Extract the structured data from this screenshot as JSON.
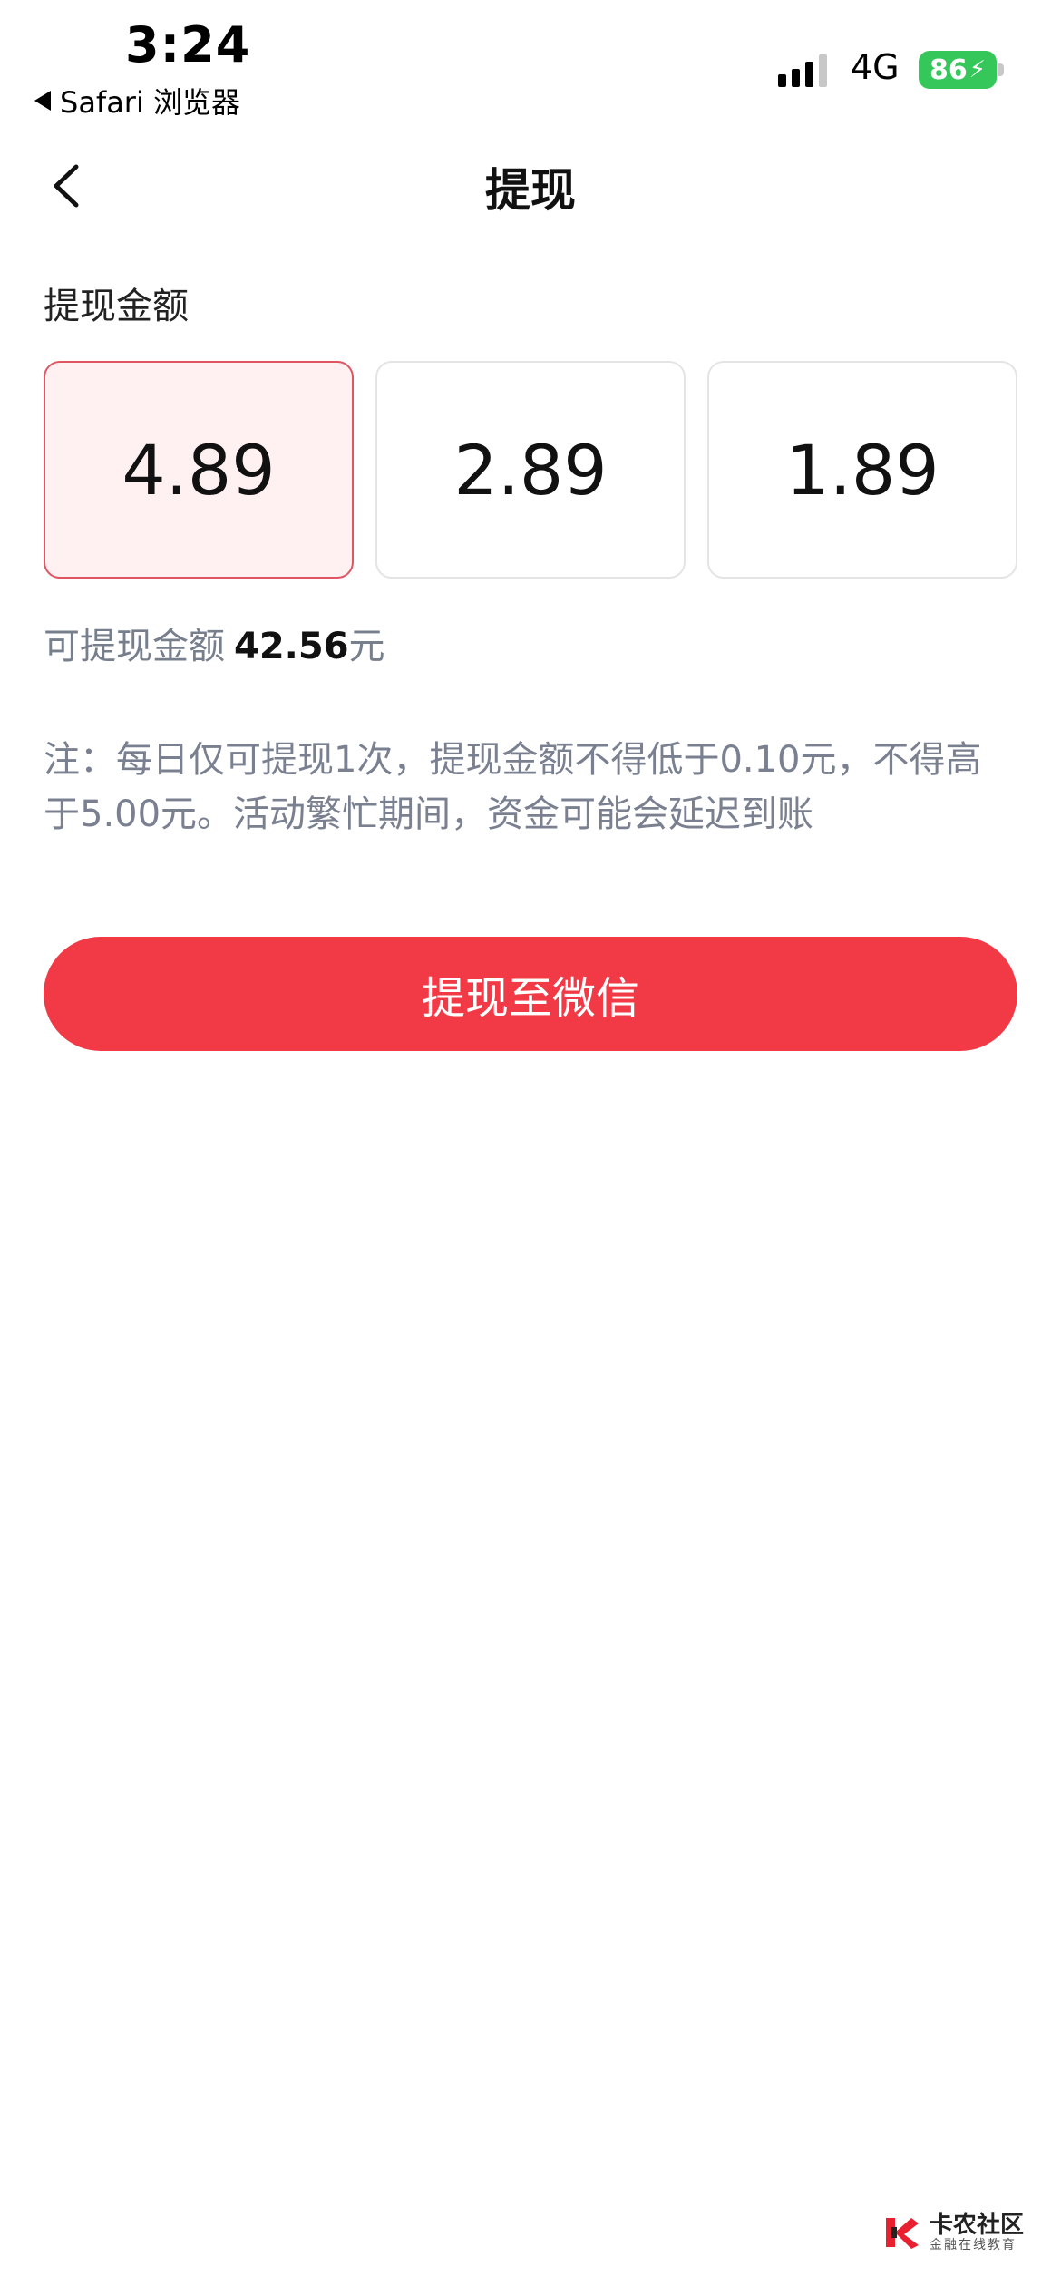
{
  "status_bar": {
    "time": "3:24",
    "back_app_label": "Safari 浏览器",
    "network": "4G",
    "battery_level": "86",
    "battery_charging_icon": "bolt-icon"
  },
  "nav": {
    "back_icon": "chevron-left-icon",
    "title": "提现"
  },
  "withdraw": {
    "section_label": "提现金额",
    "options": [
      {
        "value": "4.89",
        "selected": true
      },
      {
        "value": "2.89",
        "selected": false
      },
      {
        "value": "1.89",
        "selected": false
      }
    ],
    "available_label": "可提现金额",
    "available_amount": "42.56",
    "available_unit": "元",
    "note": "注：每日仅可提现1次，提现金额不得低于0.10元，不得高于5.00元。活动繁忙期间，资金可能会延迟到账",
    "submit_label": "提现至微信"
  },
  "watermark": {
    "title": "卡农社区",
    "subtitle": "金融在线教育"
  },
  "colors": {
    "accent": "#f23a47",
    "selected_border": "#e05562",
    "selected_bg": "#fff0f1",
    "battery": "#35c759",
    "muted_text": "#7a8090"
  }
}
